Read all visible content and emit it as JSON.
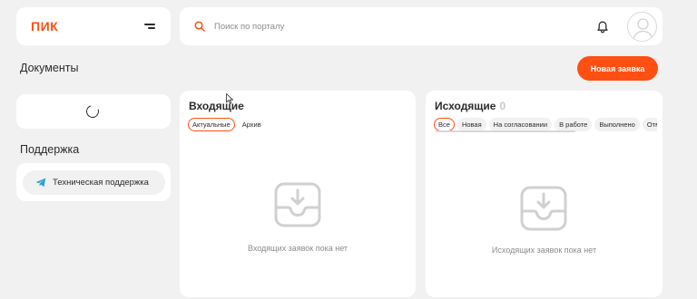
{
  "logo": {
    "text": "ПИК"
  },
  "search": {
    "placeholder": "Поиск по порталу"
  },
  "documents": {
    "title": "Документы",
    "new_request_label": "Новая заявка"
  },
  "support": {
    "title": "Поддержка",
    "tech_support_label": "Техническая поддержка"
  },
  "incoming": {
    "title": "Входящие",
    "tabs": [
      "Актуальные",
      "Архив"
    ],
    "active_tab": "Актуальные",
    "empty_text": "Входящих заявок пока нет"
  },
  "outgoing": {
    "title": "Исходящие",
    "count": "0",
    "filters": [
      "Все",
      "Новая",
      "На согласовании",
      "В работе",
      "Выполнено",
      "Отм"
    ],
    "active_filter": "Все",
    "empty_text": "Исходящих заявок пока нет"
  },
  "colors": {
    "accent": "#ff4f12",
    "background": "#f1f1f1"
  },
  "icons": [
    "menu-icon",
    "search-icon",
    "bell-icon",
    "user-avatar-icon",
    "telegram-icon",
    "inbox-download-icon",
    "loading-spinner-icon",
    "mouse-cursor-icon"
  ]
}
